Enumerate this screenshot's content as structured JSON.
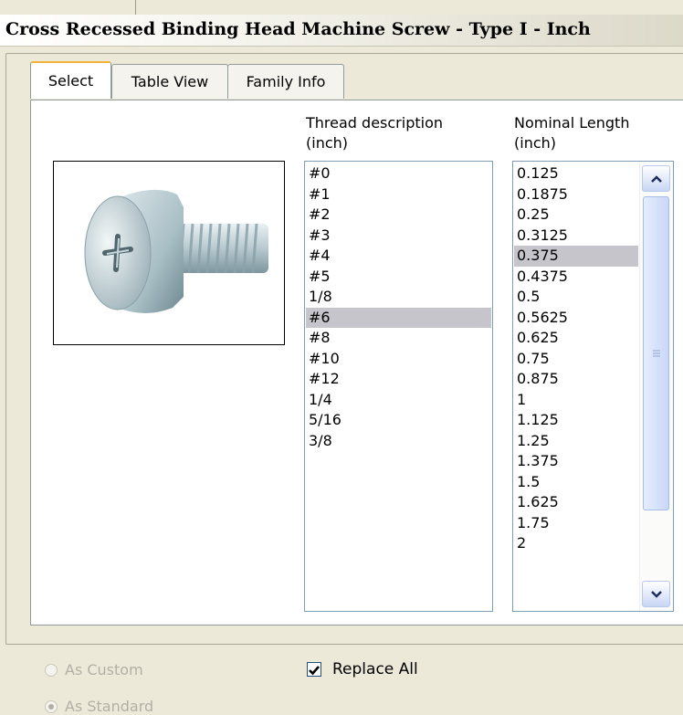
{
  "window": {
    "title": "Cross Recessed Binding Head Machine Screw - Type I - Inch"
  },
  "tabs": [
    {
      "label": "Select"
    },
    {
      "label": "Table View"
    },
    {
      "label": "Family Info"
    }
  ],
  "preview": {
    "icon": "machine-screw-image"
  },
  "thread": {
    "header": "Thread description\n(inch)",
    "items": [
      "#0",
      "#1",
      "#2",
      "#3",
      "#4",
      "#5",
      "1/8",
      "#6",
      "#8",
      "#10",
      "#12",
      "1/4",
      "5/16",
      "3/8"
    ],
    "selected": "#6"
  },
  "length": {
    "header": "Nominal Length\n(inch)",
    "items": [
      "0.125",
      "0.1875",
      "0.25",
      "0.3125",
      "0.375",
      "0.4375",
      "0.5",
      "0.5625",
      "0.625",
      "0.75",
      "0.875",
      "1",
      "1.125",
      "1.25",
      "1.375",
      "1.5",
      "1.625",
      "1.75",
      "2"
    ],
    "selected": "0.375"
  },
  "options": {
    "as_custom": "As Custom",
    "as_standard": "As Standard",
    "replace_all": "Replace All"
  }
}
